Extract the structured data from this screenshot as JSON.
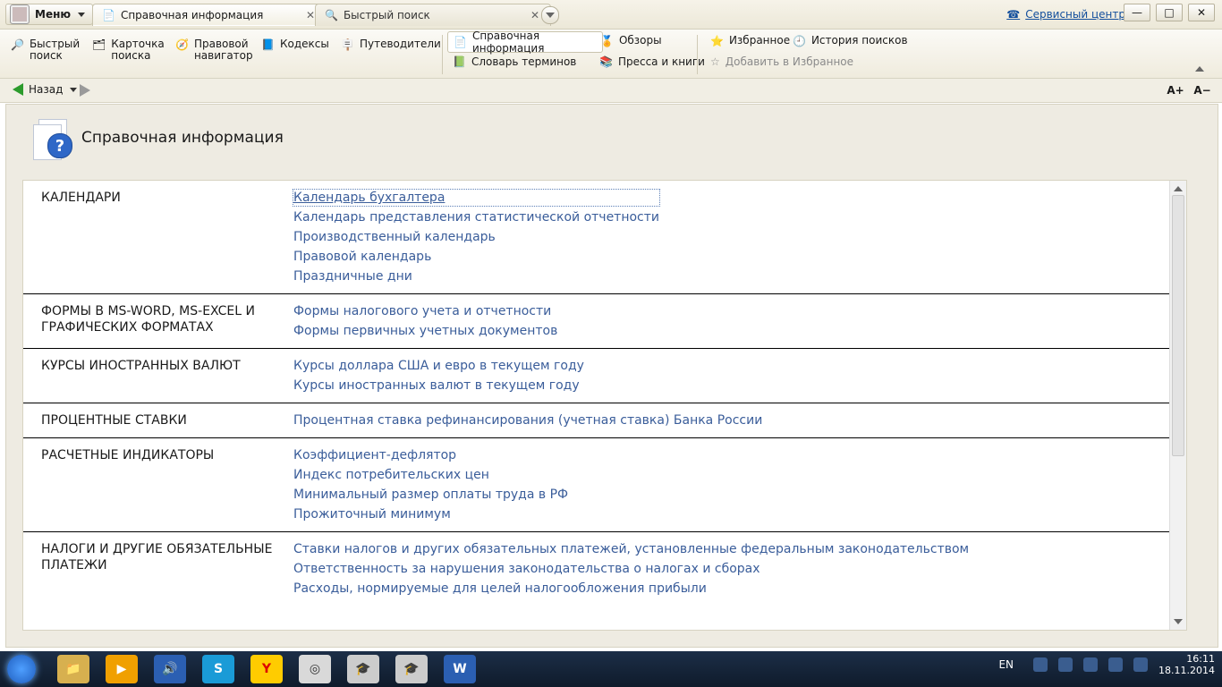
{
  "title_bar": {
    "menu_label": "Меню",
    "tabs": [
      {
        "label": "Справочная информация",
        "active": true
      },
      {
        "label": "Быстрый поиск",
        "active": false
      }
    ],
    "service_center": "Сервисный центр"
  },
  "toolbar": {
    "left_tools": [
      {
        "line1": "Быстрый",
        "line2": "поиск",
        "icon": "magnifier-icon"
      },
      {
        "line1": "Карточка",
        "line2": "поиска",
        "icon": "search-card-icon"
      },
      {
        "line1": "Правовой",
        "line2": "навигатор",
        "icon": "compass-icon"
      },
      {
        "line1": "Кодексы",
        "line2": "",
        "icon": "book-icon"
      },
      {
        "line1": "Путеводители",
        "line2": "",
        "icon": "signpost-icon"
      }
    ],
    "center_chip": {
      "label": "Справочная информация"
    },
    "center_row2_left": {
      "label": "Словарь терминов"
    },
    "center_right_top": {
      "label": "Обзоры"
    },
    "center_right_bottom": {
      "label": "Пресса и книги"
    },
    "right_top_left": {
      "label": "Избранное"
    },
    "right_top_right": {
      "label": "История поисков"
    },
    "right_bottom": {
      "label": "Добавить в Избранное"
    }
  },
  "nav": {
    "back_label": "Назад"
  },
  "page": {
    "title": "Справочная информация",
    "sections": [
      {
        "title": "КАЛЕНДАРИ",
        "links": [
          "Календарь бухгалтера",
          "Календарь представления статистической отчетности",
          "Производственный календарь",
          "Правовой календарь",
          "Праздничные дни"
        ],
        "selected_index": 0
      },
      {
        "title": "ФОРМЫ В MS-WORD, MS-EXCEL И ГРАФИЧЕСКИХ ФОРМАТАХ",
        "links": [
          "Формы налогового учета и отчетности",
          "Формы первичных учетных документов"
        ]
      },
      {
        "title": "КУРСЫ ИНОСТРАННЫХ ВАЛЮТ",
        "links": [
          "Курсы доллара США и евро в текущем году",
          "Курсы иностранных валют в текущем году"
        ]
      },
      {
        "title": "ПРОЦЕНТНЫЕ СТАВКИ",
        "links": [
          "Процентная ставка рефинансирования (учетная ставка) Банка России"
        ]
      },
      {
        "title": "РАСЧЕТНЫЕ ИНДИКАТОРЫ",
        "links": [
          "Коэффициент-дефлятор",
          "Индекс потребительских цен",
          "Минимальный размер оплаты труда в РФ",
          "Прожиточный минимум"
        ]
      },
      {
        "title": "НАЛОГИ И ДРУГИЕ ОБЯЗАТЕЛЬНЫЕ ПЛАТЕЖИ",
        "links": [
          "Ставки налогов и других обязательных платежей, установленные федеральным законодательством",
          "Ответственность за нарушения законодательства о налогах и сборах",
          "Расходы, нормируемые для целей налогообложения прибыли"
        ]
      }
    ]
  },
  "taskbar": {
    "language": "EN",
    "time": "16:11",
    "date": "18.11.2014",
    "apps": [
      "explorer",
      "media-player",
      "volume",
      "skype",
      "yandex",
      "chrome",
      "consultant1",
      "consultant2",
      "word"
    ]
  },
  "colors": {
    "accent_link": "#3a5d9a",
    "toolbar_bg": "#efebdd",
    "taskbar_bg": "#0f1b2b"
  }
}
